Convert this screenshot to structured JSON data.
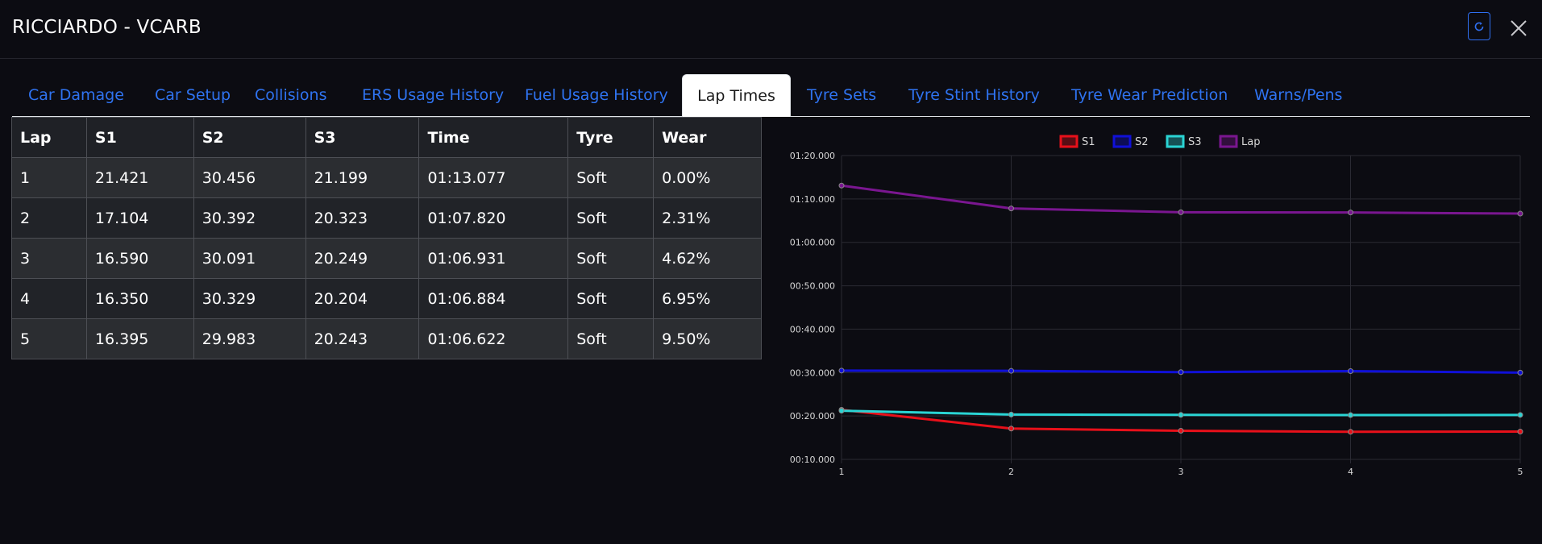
{
  "header": {
    "title": "RICCIARDO - VCARB"
  },
  "tabs": [
    {
      "label": "Car Damage"
    },
    {
      "label": "Car Setup"
    },
    {
      "label": "Collisions"
    },
    {
      "label": "ERS Usage History"
    },
    {
      "label": "Fuel Usage History"
    },
    {
      "label": "Lap Times",
      "active": true
    },
    {
      "label": "Tyre Sets"
    },
    {
      "label": "Tyre Stint History"
    },
    {
      "label": "Tyre Wear Prediction"
    },
    {
      "label": "Warns/Pens"
    }
  ],
  "table": {
    "headers": [
      "Lap",
      "S1",
      "S2",
      "S3",
      "Time",
      "Tyre",
      "Wear"
    ],
    "rows": [
      [
        "1",
        "21.421",
        "30.456",
        "21.199",
        "01:13.077",
        "Soft",
        "0.00%"
      ],
      [
        "2",
        "17.104",
        "30.392",
        "20.323",
        "01:07.820",
        "Soft",
        "2.31%"
      ],
      [
        "3",
        "16.590",
        "30.091",
        "20.249",
        "01:06.931",
        "Soft",
        "4.62%"
      ],
      [
        "4",
        "16.350",
        "30.329",
        "20.204",
        "01:06.884",
        "Soft",
        "6.95%"
      ],
      [
        "5",
        "16.395",
        "29.983",
        "20.243",
        "01:06.622",
        "Soft",
        "9.50%"
      ]
    ]
  },
  "chart_data": {
    "type": "line",
    "x": [
      1,
      2,
      3,
      4,
      5
    ],
    "series": [
      {
        "name": "S1",
        "color": "#e8101a",
        "values": [
          21.421,
          17.104,
          16.59,
          16.35,
          16.395
        ]
      },
      {
        "name": "S2",
        "color": "#1010d8",
        "values": [
          30.456,
          30.392,
          30.091,
          30.329,
          29.983
        ]
      },
      {
        "name": "S3",
        "color": "#2ad4d4",
        "values": [
          21.199,
          20.323,
          20.249,
          20.204,
          20.243
        ]
      },
      {
        "name": "Lap",
        "color": "#7a1690",
        "values": [
          73.077,
          67.82,
          66.931,
          66.884,
          66.622
        ]
      }
    ],
    "ylim": [
      10,
      80
    ],
    "yticks": [
      "01:20.000",
      "01:10.000",
      "01:00.000",
      "00:50.000",
      "00:40.000",
      "00:30.000",
      "00:20.000",
      "00:10.000"
    ],
    "xticks": [
      "1",
      "2",
      "3",
      "4",
      "5"
    ],
    "legend": "top-center",
    "grid": true
  }
}
